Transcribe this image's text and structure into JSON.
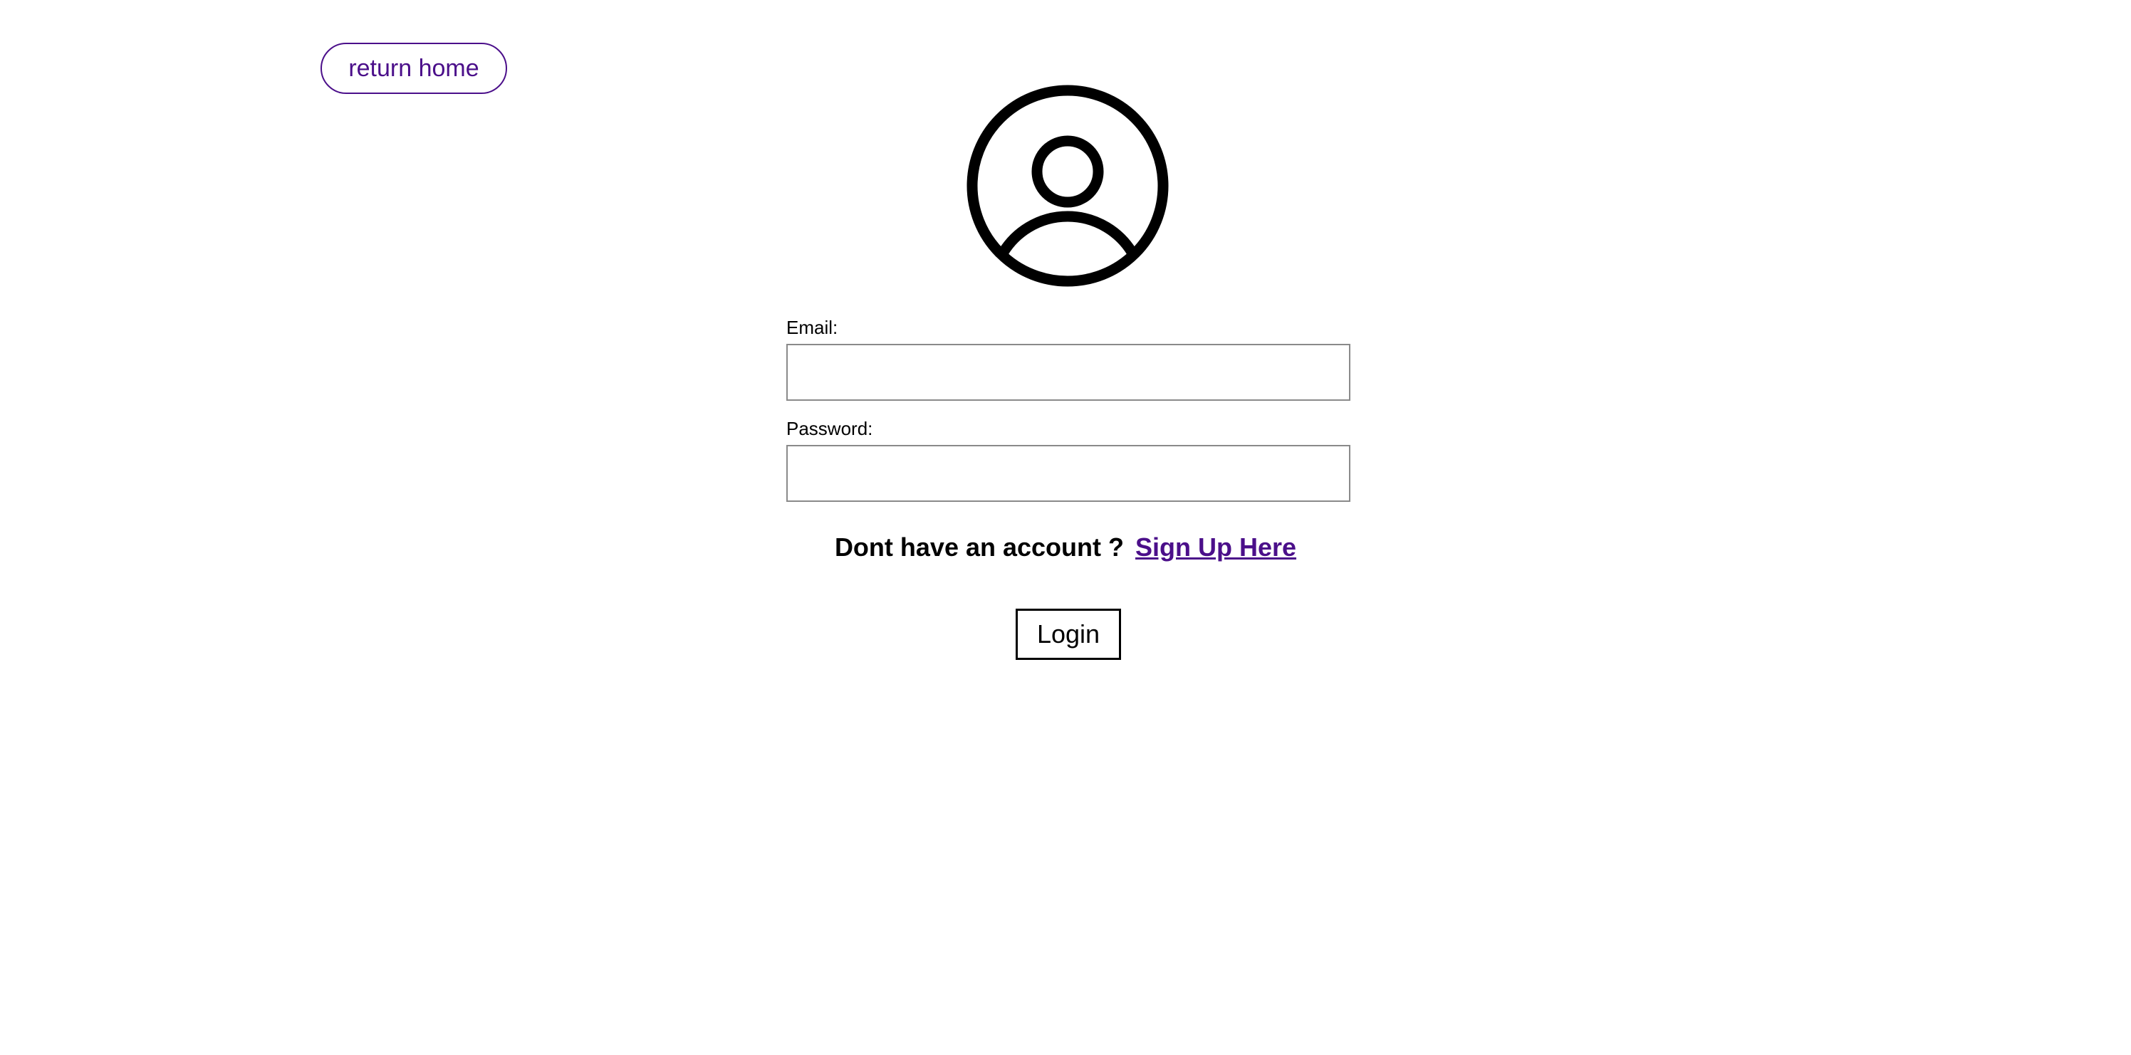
{
  "nav": {
    "return_home_label": "return home"
  },
  "icons": {
    "avatar": "user-circle-icon"
  },
  "form": {
    "email_label": "Email:",
    "email_value": "",
    "email_placeholder": "",
    "password_label": "Password:",
    "password_value": "",
    "password_placeholder": "",
    "signup_prompt": "Dont have an account ?",
    "signup_link": "Sign Up Here",
    "login_label": "Login"
  },
  "colors": {
    "accent": "#4b0f8a",
    "text": "#000000",
    "input_border": "#8a8a8a",
    "background": "#ffffff"
  }
}
